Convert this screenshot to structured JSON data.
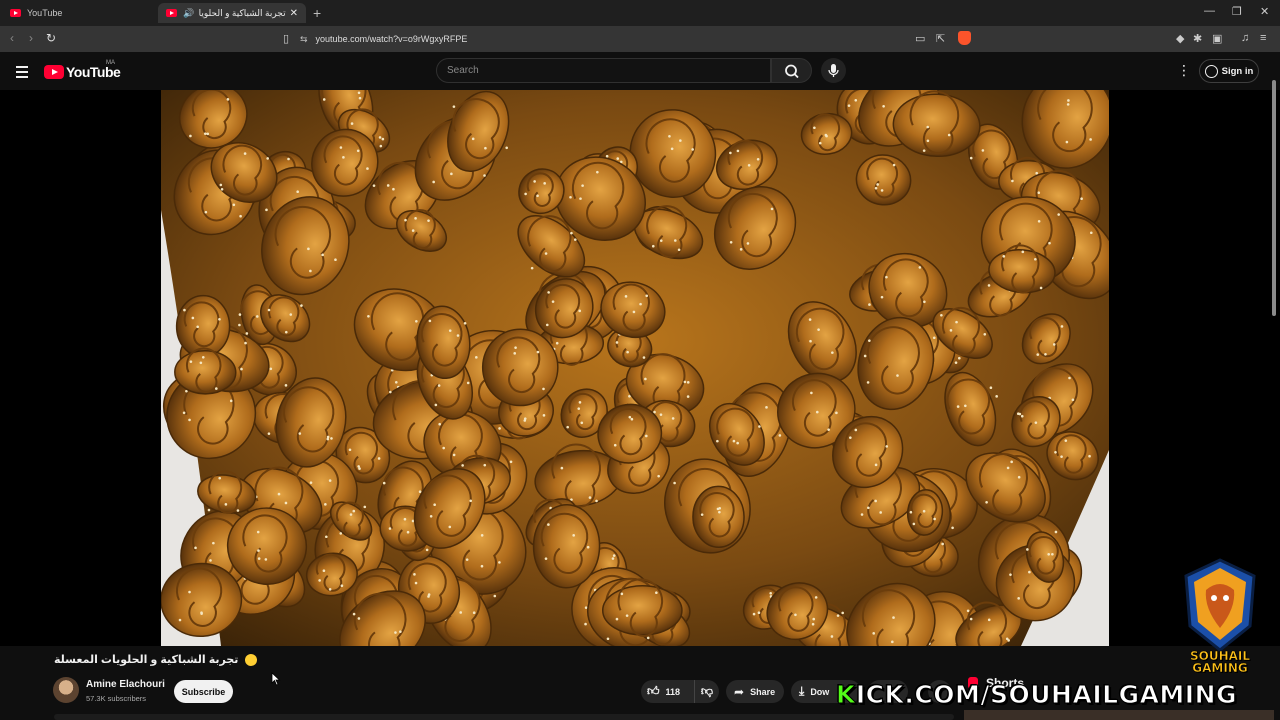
{
  "browser": {
    "tabs": [
      {
        "title": "YouTube",
        "active": false
      },
      {
        "title": "تجربة الشباكية و الحلويات المعسلة",
        "active": true
      }
    ],
    "url": "youtube.com/watch?v=o9rWgxyRFPE"
  },
  "header": {
    "logo_text": "YouTube",
    "country_code": "MA",
    "search_placeholder": "Search",
    "signin_label": "Sign in"
  },
  "video": {
    "title": "تجربة الشباكية و الحلويات المعسلة",
    "description_of_frame": "",
    "channel": {
      "name": "Amine Elachouri",
      "subscribers": "57.3K subscribers"
    },
    "subscribe_label": "Subscribe",
    "actions": {
      "likes": "118",
      "share_label": "Share",
      "download_label": "Dow"
    }
  },
  "sidebar": {
    "shorts_label": "Shorts"
  },
  "overlay": {
    "kick_prefix": "K",
    "kick_rest": "ICK.COM/SOUHAILGAMING",
    "badge_line1": "SOUHAIL",
    "badge_line2": "GAMING"
  },
  "colors": {
    "youtube_red": "#ff0033",
    "kick_green": "#53fc18",
    "background": "#0f0f0f"
  },
  "icons": [
    "youtube-favicon",
    "speaker-icon",
    "close-icon",
    "plus-icon",
    "back-icon",
    "forward-icon",
    "reload-icon",
    "bookmark-icon",
    "site-info-icon",
    "brave-shield-icon",
    "menu-icon",
    "search-icon",
    "mic-icon",
    "more-icon",
    "account-icon",
    "like-icon",
    "dislike-icon",
    "share-icon",
    "download-icon",
    "shorts-icon"
  ]
}
